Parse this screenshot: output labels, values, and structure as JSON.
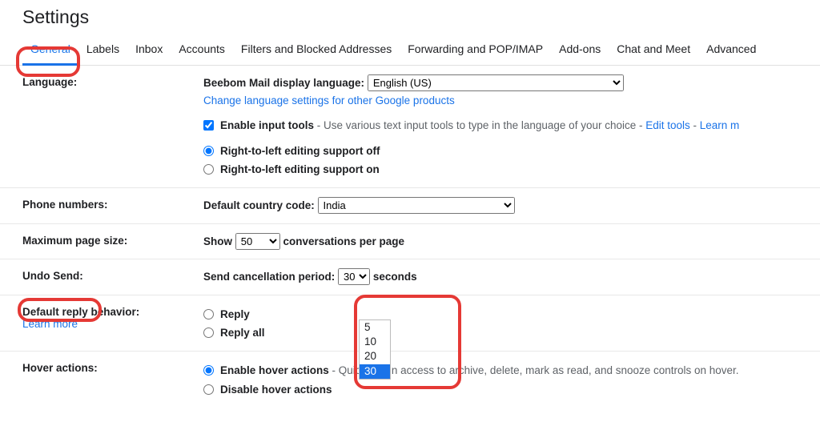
{
  "page_title": "Settings",
  "tabs": {
    "general": "General",
    "labels": "Labels",
    "inbox": "Inbox",
    "accounts": "Accounts",
    "filters": "Filters and Blocked Addresses",
    "forwarding": "Forwarding and POP/IMAP",
    "addons": "Add-ons",
    "chat": "Chat and Meet",
    "advanced": "Advanced"
  },
  "language": {
    "label": "Language:",
    "display_label": "Beebom Mail display language:",
    "selected": "English (US)",
    "change_link": "Change language settings for other Google products",
    "enable_tools_label": "Enable input tools",
    "enable_tools_desc": " - Use various text input tools to type in the language of your choice - ",
    "edit_tools": "Edit tools",
    "learn_more": "Learn m",
    "rtl_off": "Right-to-left editing support off",
    "rtl_on": "Right-to-left editing support on",
    "separator": " - "
  },
  "phone": {
    "label": "Phone numbers:",
    "country_label": "Default country code:",
    "selected": "India"
  },
  "pagesize": {
    "label": "Maximum page size:",
    "show": "Show ",
    "selected": "50",
    "per_page": " conversations per page"
  },
  "undo": {
    "label": "Undo Send:",
    "period_label": "Send cancellation period:",
    "selected": "30",
    "seconds": " seconds",
    "options": {
      "o1": "5",
      "o2": "10",
      "o3": "20",
      "o4": "30"
    }
  },
  "reply": {
    "label": "Default reply behavior:",
    "learn_more": "Learn more",
    "reply": "Reply",
    "reply_all": "Reply all"
  },
  "hover": {
    "label": "Hover actions:",
    "enable": "Enable hover actions",
    "enable_desc": " - Quickly gain access to archive, delete, mark as read, and snooze controls on hover.",
    "disable": "Disable hover actions"
  }
}
